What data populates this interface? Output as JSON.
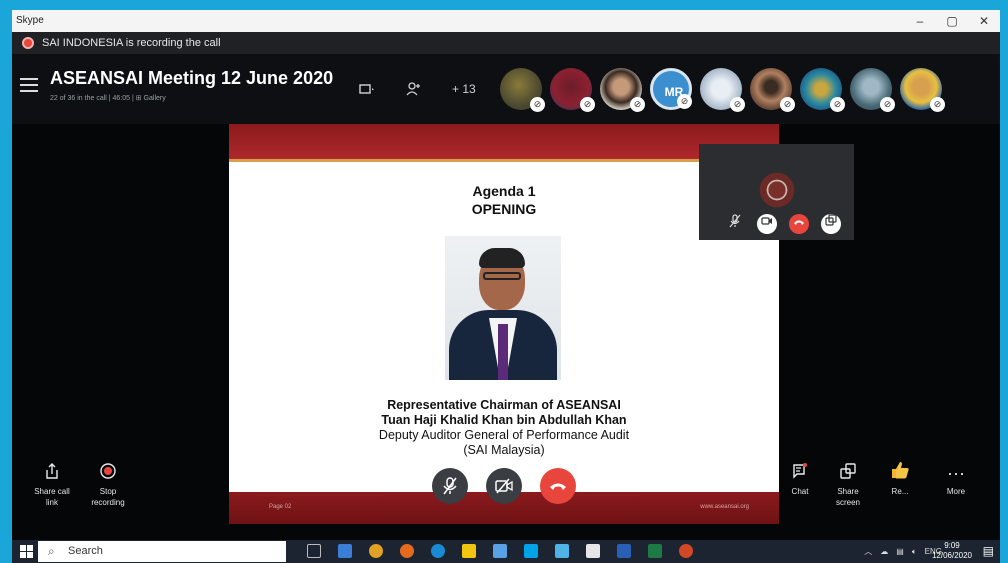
{
  "window": {
    "app_title": "Skype",
    "controls": [
      "–",
      "▢",
      "✕"
    ]
  },
  "recording_bar": {
    "text": "SAI INDONESIA is recording the call"
  },
  "call_header": {
    "title": "ASEANSAI Meeting 12 June 2020",
    "subtitle": "22 of 36 in the call | 46:05  |  ⊞ Gallery",
    "extra_participants": "+ 13",
    "avatar_initials": "MR"
  },
  "slide": {
    "agenda_line1": "Agenda 1",
    "agenda_line2": "OPENING",
    "caption_line1": "Representative Chairman of ASEANSAI",
    "caption_line2": "Tuan Haji Khalid Khan bin Abdullah Khan",
    "caption_line3": "Deputy Auditor General of Performance Audit",
    "caption_line4": "(SAI Malaysia)",
    "footer_left": "Page 02",
    "footer_right": "www.aseansai.org"
  },
  "bottom_left": {
    "share_link_label_1": "Share call",
    "share_link_label_2": "link",
    "stop_recording_label_1": "Stop",
    "stop_recording_label_2": "recording"
  },
  "bottom_right": {
    "chat_label": "Chat",
    "share_screen_label_1": "Share",
    "share_screen_label_2": "screen",
    "react_label": "Re...",
    "more_label": "More",
    "more_glyph": "···"
  },
  "taskbar": {
    "search_placeholder": "Search",
    "lang": "ENG",
    "time": "9:09",
    "date": "12/06/2020"
  },
  "colors": {
    "frame": "#1aa6d9",
    "end_call": "#e8463d",
    "slide_red": "#8b1a1d"
  }
}
